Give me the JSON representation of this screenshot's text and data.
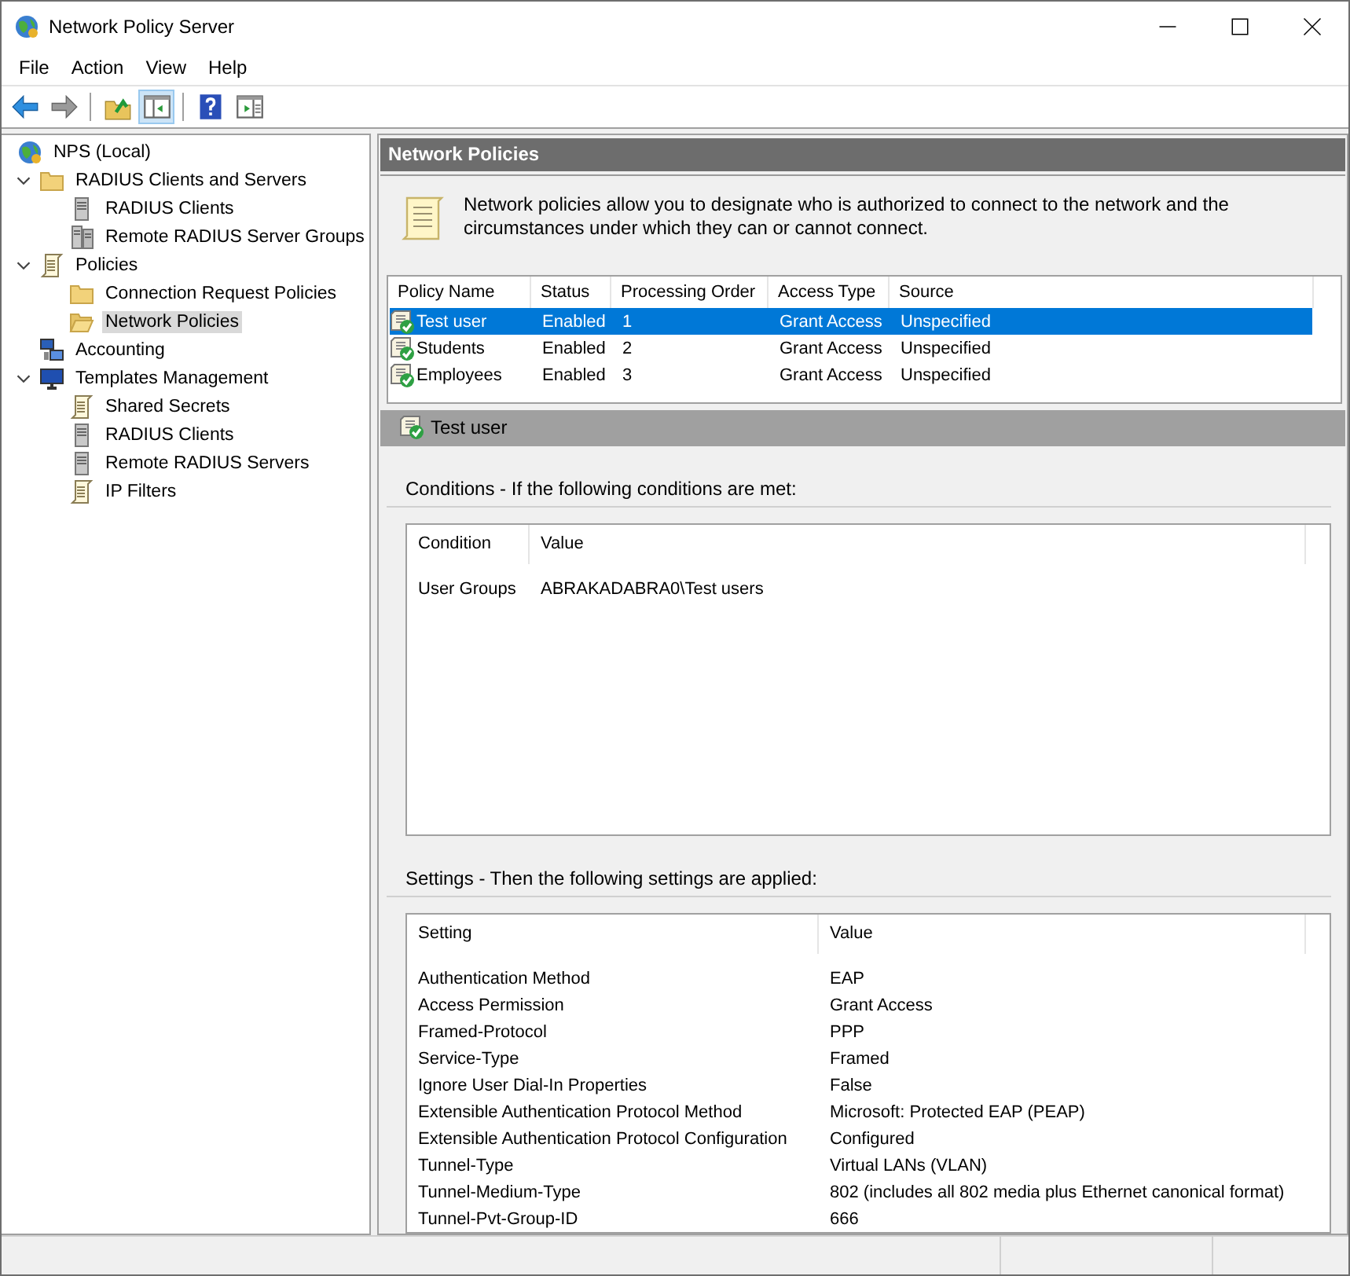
{
  "window": {
    "title": "Network Policy Server"
  },
  "menu": [
    "File",
    "Action",
    "View",
    "Help"
  ],
  "toolbar": [
    {
      "kind": "back",
      "disabled": false,
      "pressed": false
    },
    {
      "kind": "forward",
      "disabled": true,
      "pressed": false
    },
    {
      "kind": "separator"
    },
    {
      "kind": "up",
      "pressed": false
    },
    {
      "kind": "tree",
      "pressed": true
    },
    {
      "kind": "separator"
    },
    {
      "kind": "help",
      "pressed": false
    },
    {
      "kind": "actionpane",
      "pressed": false
    }
  ],
  "tree": [
    {
      "label": "NPS (Local)",
      "kind": "globe",
      "selected": false,
      "children": [
        {
          "label": "RADIUS Clients and Servers",
          "kind": "folder",
          "selected": false,
          "expanded": true,
          "children": [
            {
              "label": "RADIUS Clients",
              "kind": "server",
              "selected": false
            },
            {
              "label": "Remote RADIUS Server Groups",
              "kind": "servers",
              "selected": false
            }
          ]
        },
        {
          "label": "Policies",
          "kind": "document",
          "selected": false,
          "expanded": true,
          "children": [
            {
              "label": "Connection Request Policies",
              "kind": "folder",
              "selected": false
            },
            {
              "label": "Network Policies",
              "kind": "folder-open",
              "selected": true
            }
          ]
        },
        {
          "label": "Accounting",
          "kind": "computers",
          "selected": false
        },
        {
          "label": "Templates Management",
          "kind": "monitor",
          "selected": false,
          "expanded": true,
          "children": [
            {
              "label": "Shared Secrets",
              "kind": "document",
              "selected": false
            },
            {
              "label": "RADIUS Clients",
              "kind": "server",
              "selected": false
            },
            {
              "label": "Remote RADIUS Servers",
              "kind": "server",
              "selected": false
            },
            {
              "label": "IP Filters",
              "kind": "document",
              "selected": false
            }
          ]
        }
      ]
    }
  ],
  "panel": {
    "title": "Network Policies",
    "description": "Network policies allow you to designate who is authorized to connect to the network and the circumstances under which they can or cannot connect."
  },
  "policies": {
    "columns": [
      "Policy Name",
      "Status",
      "Processing Order",
      "Access Type",
      "Source"
    ],
    "rows": [
      {
        "cells": [
          "Test user",
          "Enabled",
          "1",
          "Grant Access",
          "Unspecified"
        ],
        "selected": true
      },
      {
        "cells": [
          "Students",
          "Enabled",
          "2",
          "Grant Access",
          "Unspecified"
        ],
        "selected": false
      },
      {
        "cells": [
          "Employees",
          "Enabled",
          "3",
          "Grant Access",
          "Unspecified"
        ],
        "selected": false
      }
    ]
  },
  "detail": {
    "title": "Test user",
    "conditions": {
      "heading": "Conditions - If the following conditions are met:",
      "columns": [
        "Condition",
        "Value"
      ],
      "rows": [
        [
          "User Groups",
          "ABRAKADABRA0\\Test users"
        ]
      ]
    },
    "settings": {
      "heading": "Settings - Then the following settings are applied:",
      "columns": [
        "Setting",
        "Value"
      ],
      "rows": [
        [
          "Authentication Method",
          "EAP"
        ],
        [
          "Access Permission",
          "Grant Access"
        ],
        [
          "Framed-Protocol",
          "PPP"
        ],
        [
          "Service-Type",
          "Framed"
        ],
        [
          "Ignore User Dial-In Properties",
          "False"
        ],
        [
          "Extensible Authentication Protocol Method",
          "Microsoft: Protected EAP (PEAP)"
        ],
        [
          "Extensible Authentication Protocol Configuration",
          "Configured"
        ],
        [
          "Tunnel-Type",
          "Virtual LANs (VLAN)"
        ],
        [
          "Tunnel-Medium-Type",
          "802 (includes all 802 media plus Ethernet canonical format)"
        ],
        [
          "Tunnel-Pvt-Group-ID",
          "666"
        ]
      ]
    }
  }
}
